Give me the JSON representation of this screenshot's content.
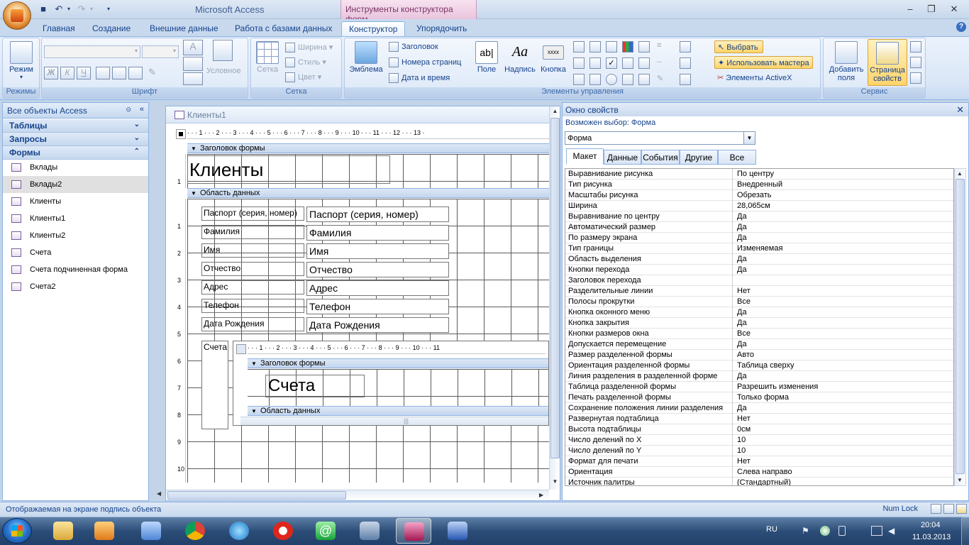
{
  "window": {
    "title": "Microsoft Access",
    "context_tab": "Инструменты конструктора форм"
  },
  "ribbon_tabs": [
    "Главная",
    "Создание",
    "Внешние данные",
    "Работа с базами данных",
    "Конструктор",
    "Упорядочить"
  ],
  "ribbon": {
    "views": {
      "mode_label": "Режим",
      "group": "Режимы"
    },
    "font": {
      "group": "Шрифт",
      "bold": "Ж",
      "italic": "К",
      "underline": "Ч",
      "conditional": "Условное"
    },
    "grid": {
      "grid_label": "Сетка",
      "width": "Ширина",
      "style": "Стиль",
      "color": "Цвет",
      "group": "Сетка"
    },
    "controls": {
      "group": "Элементы управления",
      "logo": "Эмблема",
      "title": "Заголовок",
      "page_numbers": "Номера страниц",
      "date_time": "Дата и время",
      "field": "Поле",
      "label": "Надпись",
      "button": "Кнопка",
      "textbox_icon": "ab|",
      "label_icon": "Aa",
      "button_icon": "xxxx",
      "select": "Выбрать",
      "use_wizards": "Использовать мастера",
      "activex": "Элементы ActiveX"
    },
    "tools": {
      "group": "Сервис",
      "add_fields": "Добавить поля",
      "property_sheet": "Страница свойств"
    }
  },
  "nav": {
    "header": "Все объекты Access",
    "sections": [
      "Таблицы",
      "Запросы",
      "Формы"
    ],
    "forms": [
      "Вклады",
      "Вклады2",
      "Клиенты",
      "Клиенты1",
      "Клиенты2",
      "Счета",
      "Счета подчиненная форма",
      "Счета2"
    ],
    "selected_index": 1
  },
  "design": {
    "doc_title": "Клиенты1",
    "header_section": "Заголовок формы",
    "detail_section": "Область данных",
    "form_title": "Клиенты",
    "ruler_marks": [
      "1",
      "2",
      "3",
      "4",
      "5",
      "6",
      "7",
      "8",
      "9",
      "10",
      "11",
      "12",
      "13"
    ],
    "vruler_top": [
      "1"
    ],
    "vruler_detail": [
      "1",
      "2",
      "3",
      "4",
      "5",
      "6",
      "7",
      "8",
      "9",
      "10"
    ],
    "fields": [
      {
        "label": "Паспорт (серия, номер)",
        "value": "Паспорт (серия, номер)"
      },
      {
        "label": "Фамилия",
        "value": "Фамилия"
      },
      {
        "label": "Имя",
        "value": "Имя"
      },
      {
        "label": "Отчество",
        "value": "Отчество"
      },
      {
        "label": "Адрес",
        "value": "Адрес"
      },
      {
        "label": "Телефон",
        "value": "Телефон"
      },
      {
        "label": "Дата Рождения",
        "value": "Дата Рождения"
      }
    ],
    "subform": {
      "label": "Счета",
      "header_section": "Заголовок формы",
      "detail_section": "Область данных",
      "title": "Счета",
      "ruler_marks": [
        "1",
        "2",
        "3",
        "4",
        "5",
        "6",
        "7",
        "8",
        "9",
        "10",
        "11"
      ]
    }
  },
  "props": {
    "title": "Окно свойств",
    "selection_type": "Возможен выбор:  Форма",
    "selected_object": "Форма",
    "tabs": [
      "Макет",
      "Данные",
      "События",
      "Другие",
      "Все"
    ],
    "active_tab": 0,
    "rows": [
      [
        "Выравнивание рисунка",
        "По центру"
      ],
      [
        "Тип рисунка",
        "Внедренный"
      ],
      [
        "Масштабы рисунка",
        "Обрезать"
      ],
      [
        "Ширина",
        "28,065см"
      ],
      [
        "Выравнивание по центру",
        "Да"
      ],
      [
        "Автоматический размер",
        "Да"
      ],
      [
        "По размеру экрана",
        "Да"
      ],
      [
        "Тип границы",
        "Изменяемая"
      ],
      [
        "Область выделения",
        "Да"
      ],
      [
        "Кнопки перехода",
        "Да"
      ],
      [
        "Заголовок перехода",
        ""
      ],
      [
        "Разделительные линии",
        "Нет"
      ],
      [
        "Полосы прокрутки",
        "Все"
      ],
      [
        "Кнопка оконного меню",
        "Да"
      ],
      [
        "Кнопка закрытия",
        "Да"
      ],
      [
        "Кнопки размеров окна",
        "Все"
      ],
      [
        "Допускается перемещение",
        "Да"
      ],
      [
        "Размер разделенной формы",
        "Авто"
      ],
      [
        "Ориентация разделенной формы",
        "Таблица сверху"
      ],
      [
        "Линия разделения в разделенной форме",
        "Да"
      ],
      [
        "Таблица разделенной формы",
        "Разрешить изменения"
      ],
      [
        "Печать разделенной формы",
        "Только форма"
      ],
      [
        "Сохранение положения линии разделения",
        "Да"
      ],
      [
        "Развернутая подтаблица",
        "Нет"
      ],
      [
        "Высота подтаблицы",
        "0см"
      ],
      [
        "Число делений по X",
        "10"
      ],
      [
        "Число делений по Y",
        "10"
      ],
      [
        "Формат для печати",
        "Нет"
      ],
      [
        "Ориентация",
        "Слева направо"
      ],
      [
        "Источник палитры",
        "(Стандартный)"
      ]
    ]
  },
  "status": {
    "text": "Отображаемая на экране подпись объекта",
    "numlock": "Num Lock"
  },
  "taskbar": {
    "lang": "RU",
    "time": "20:04",
    "date": "11.03.2013"
  },
  "colors": {
    "accent": "#15428b",
    "ribbon": "#dbe7f7",
    "context": "#e9c4dd",
    "taskbar": "#2c4d77"
  }
}
